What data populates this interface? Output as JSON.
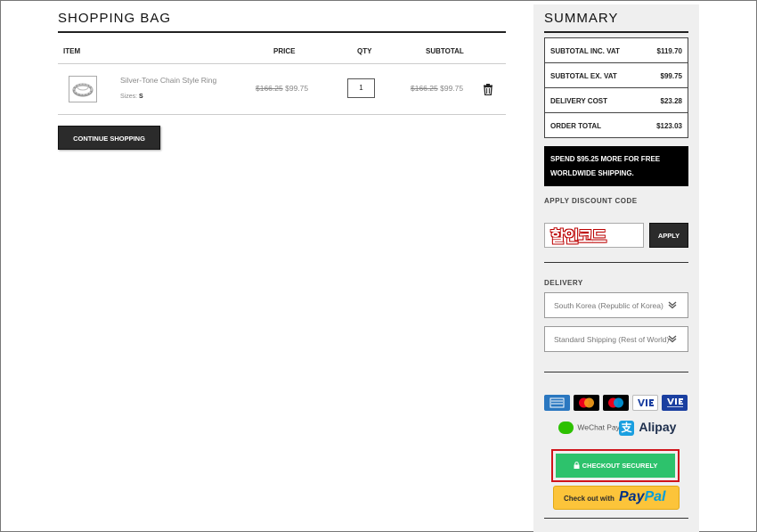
{
  "bag": {
    "title": "SHOPPING BAG",
    "headers": {
      "item": "ITEM",
      "price": "PRICE",
      "qty": "QTY",
      "subtotal": "SUBTOTAL"
    },
    "item": {
      "name": "Silver-Tone Chain Style Ring",
      "size_label": "Sizes:",
      "size_value": "S",
      "price_original": "$166.25",
      "price_sale": "$99.75",
      "qty": "1",
      "subtotal_original": "$166.25",
      "subtotal_sale": "$99.75"
    },
    "continue_label": "CONTINUE SHOPPING"
  },
  "summary": {
    "title": "SUMMARY",
    "rows": [
      {
        "label": "SUBTOTAL INC. VAT",
        "value": "$119.70"
      },
      {
        "label": "SUBTOTAL EX. VAT",
        "value": "$99.75"
      },
      {
        "label": "DELIVERY COST",
        "value": "$23.28"
      },
      {
        "label": "ORDER TOTAL",
        "value": "$123.03"
      }
    ],
    "promo": "SPEND $95.25 MORE FOR FREE WORLDWIDE SHIPPING.",
    "discount_label": "APPLY DISCOUNT CODE",
    "discount_value": "할인코드",
    "apply_label": "APPLY",
    "delivery_label": "DELIVERY",
    "country": "South Korea (Republic of Korea)",
    "shipping": "Standard Shipping (Rest of World)",
    "wechat_label": "WeChat Pay",
    "alipay_label": "Alipay",
    "alipay_glyph": "支",
    "checkout_label": "CHECKOUT SECURELY",
    "paypal_pre": "Check out with",
    "paypal_a": "Pay",
    "paypal_b": "Pal"
  },
  "colors": {
    "checkout": "#2dc26c",
    "checkout_outline": "#d0141b",
    "paypal": "#fcc43a",
    "promo_bg": "#000000"
  },
  "icons": [
    "trash-icon",
    "lock-icon",
    "chevron-down-icon",
    "amex-card-icon",
    "mastercard-icon",
    "maestro-icon",
    "visa-icon",
    "visa-electron-icon",
    "wechat-icon",
    "alipay-icon",
    "ring-image"
  ]
}
